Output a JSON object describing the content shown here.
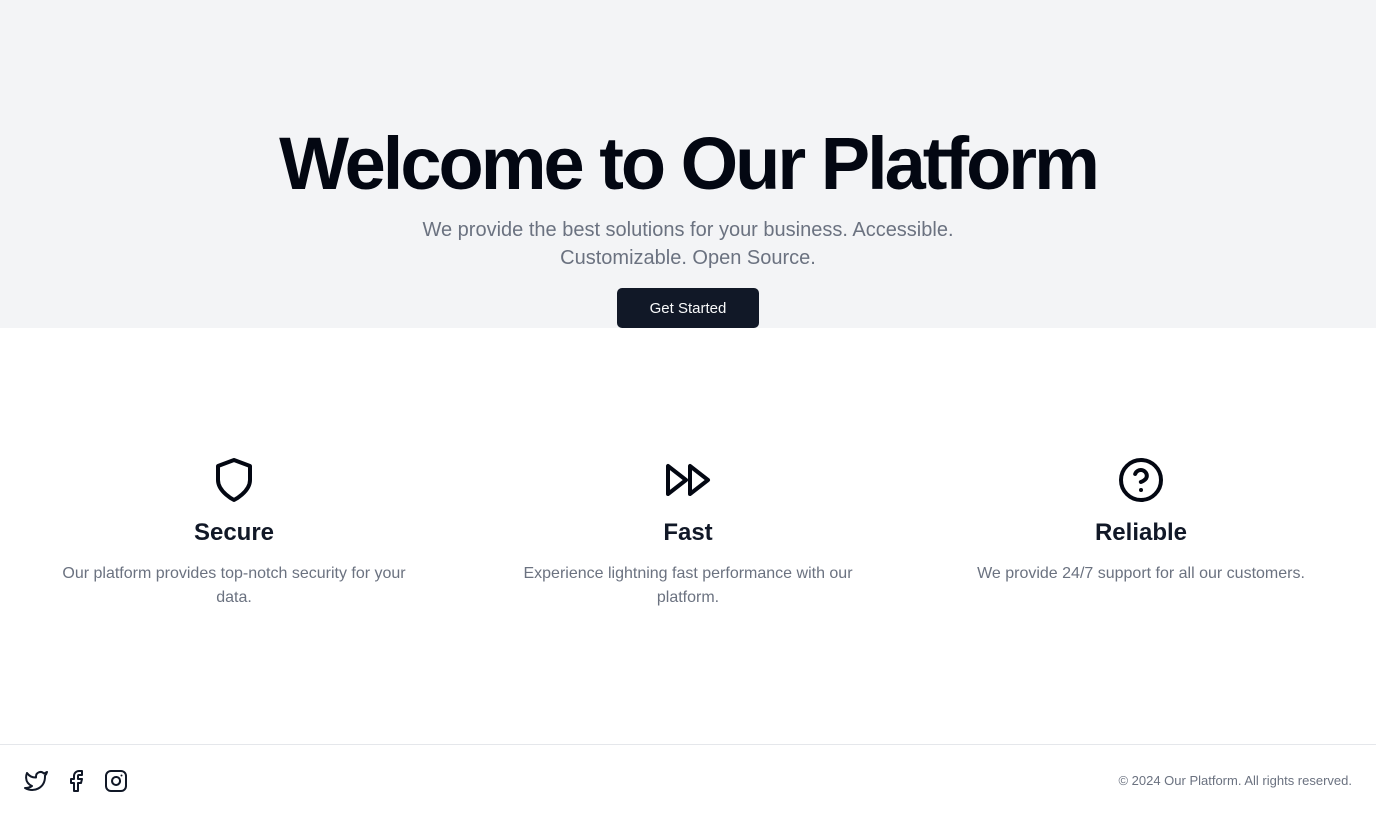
{
  "hero": {
    "title": "Welcome to Our Platform",
    "subtitle": "We provide the best solutions for your business. Accessible. Customizable. Open Source.",
    "cta_label": "Get Started"
  },
  "features": [
    {
      "icon": "shield-icon",
      "title": "Secure",
      "description": "Our platform provides top-notch security for your data."
    },
    {
      "icon": "fast-forward-icon",
      "title": "Fast",
      "description": "Experience lightning fast performance with our platform."
    },
    {
      "icon": "help-circle-icon",
      "title": "Reliable",
      "description": "We provide 24/7 support for all our customers."
    }
  ],
  "footer": {
    "social": [
      "twitter-icon",
      "facebook-icon",
      "instagram-icon"
    ],
    "copyright": "© 2024 Our Platform. All rights reserved."
  },
  "colors": {
    "hero_bg": "#f3f4f6",
    "button_bg": "#111827",
    "muted_text": "#6b7280"
  }
}
